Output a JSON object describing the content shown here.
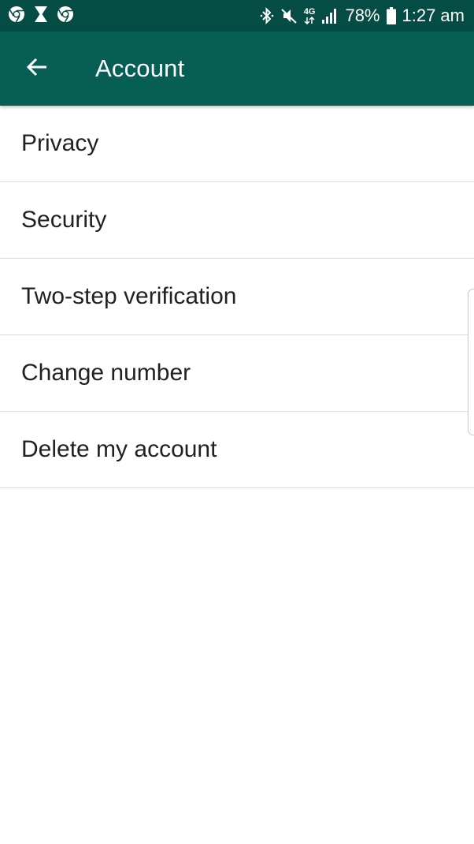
{
  "status_bar": {
    "left_icons": [
      "chrome-icon",
      "hourglass-icon",
      "chrome-icon"
    ],
    "right_icons": [
      "bluetooth-icon",
      "mute-icon",
      "network-4g-icon",
      "signal-icon"
    ],
    "network_label": "4G",
    "battery_percent": "78%",
    "time": "1:27 am"
  },
  "app_bar": {
    "title": "Account",
    "back_icon": "arrow-left-icon"
  },
  "menu": {
    "items": [
      {
        "label": "Privacy"
      },
      {
        "label": "Security"
      },
      {
        "label": "Two-step verification"
      },
      {
        "label": "Change number"
      },
      {
        "label": "Delete my account"
      }
    ]
  },
  "colors": {
    "status_bar": "#054d44",
    "app_bar": "#075e54",
    "divider": "#dcdcdc",
    "text": "#212121"
  }
}
